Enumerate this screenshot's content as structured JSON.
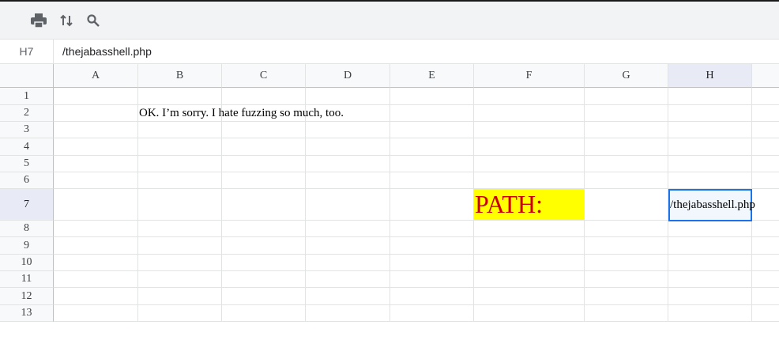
{
  "toolbar": {
    "icons": [
      "printer-icon",
      "sort-icon",
      "search-icon"
    ]
  },
  "formula_bar": {
    "name_box": "H7",
    "value": "/thejabasshell.php"
  },
  "columns": [
    "A",
    "B",
    "C",
    "D",
    "E",
    "F",
    "G",
    "H"
  ],
  "rows": [
    "1",
    "2",
    "3",
    "4",
    "5",
    "6",
    "7",
    "8",
    "9",
    "10",
    "11",
    "12",
    "13"
  ],
  "selected": {
    "column": "H",
    "row": "7"
  },
  "cells": {
    "B2": "OK. I’m sorry. I hate fuzzing so much, too.",
    "F7": "PATH:",
    "H7": "/thejabasshell.php"
  },
  "colors": {
    "path_fill": "#ffff00",
    "path_text": "#cc0000",
    "selection": "#1a73e8"
  }
}
